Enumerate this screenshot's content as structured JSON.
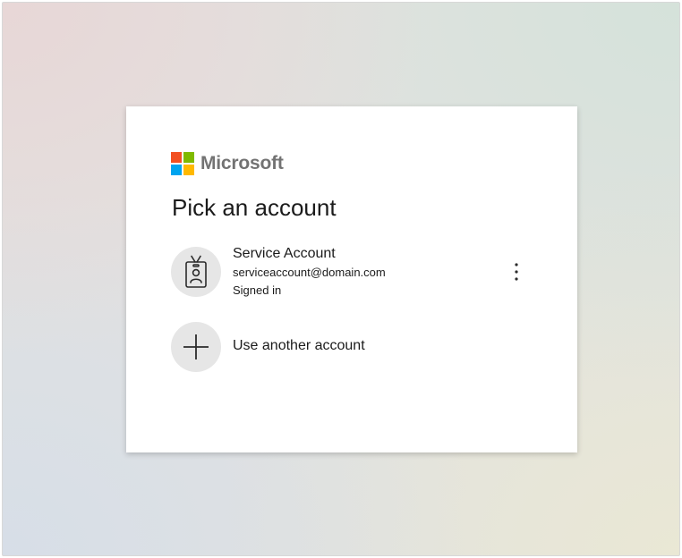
{
  "brand": {
    "name": "Microsoft",
    "colors": [
      "#f25022",
      "#7fba00",
      "#00a4ef",
      "#ffb900"
    ]
  },
  "title": "Pick an account",
  "accounts": [
    {
      "name": "Service Account",
      "email": "serviceaccount@domain.com",
      "status": "Signed in",
      "avatar_icon": "badge-person-icon"
    }
  ],
  "other_account": {
    "label": "Use another account",
    "icon": "plus-icon"
  },
  "more_options_icon": "vertical-ellipsis-icon"
}
